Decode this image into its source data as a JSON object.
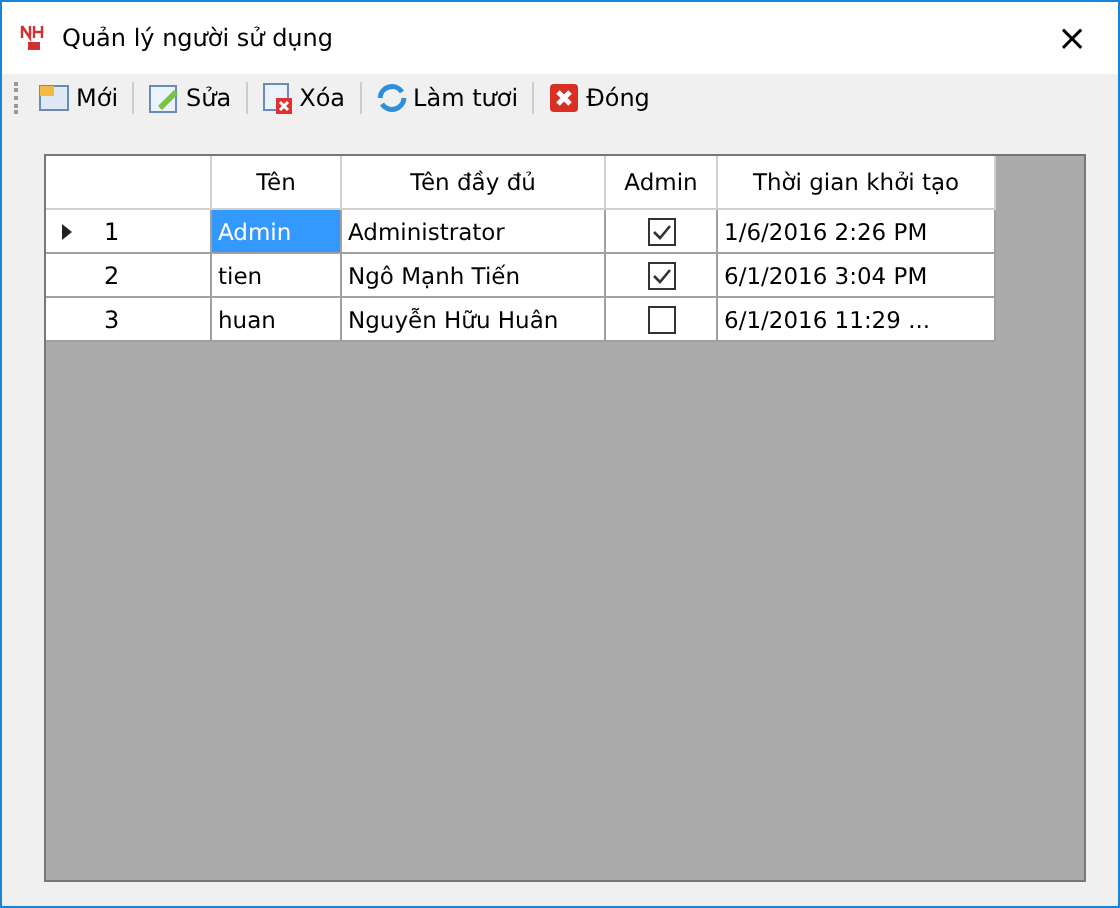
{
  "window": {
    "title": "Quản lý người sử dụng",
    "close": "×"
  },
  "toolbar": [
    {
      "kind": "new",
      "label": "Mới"
    },
    {
      "kind": "edit",
      "label": "Sửa"
    },
    {
      "kind": "delete",
      "label": "Xóa"
    },
    {
      "kind": "refresh",
      "label": "Làm tươi"
    },
    {
      "kind": "close",
      "label": "Đóng"
    }
  ],
  "table": {
    "columns": [
      "Tên",
      "Tên đầy đủ",
      "Admin",
      "Thời gian khởi tạo"
    ],
    "rows": [
      {
        "number": "1",
        "name": "Admin",
        "full_name": "Administrator",
        "admin": true,
        "created": "1/6/2016 2:26 PM",
        "selected": true
      },
      {
        "number": "2",
        "name": "tien",
        "full_name": "Ngô Mạnh Tiến",
        "admin": true,
        "created": "6/1/2016 3:04 PM",
        "selected": false
      },
      {
        "number": "3",
        "name": "huan",
        "full_name": "Nguyễn Hữu Huân",
        "admin": false,
        "created": "6/1/2016 11:29 ...",
        "selected": false
      }
    ]
  }
}
